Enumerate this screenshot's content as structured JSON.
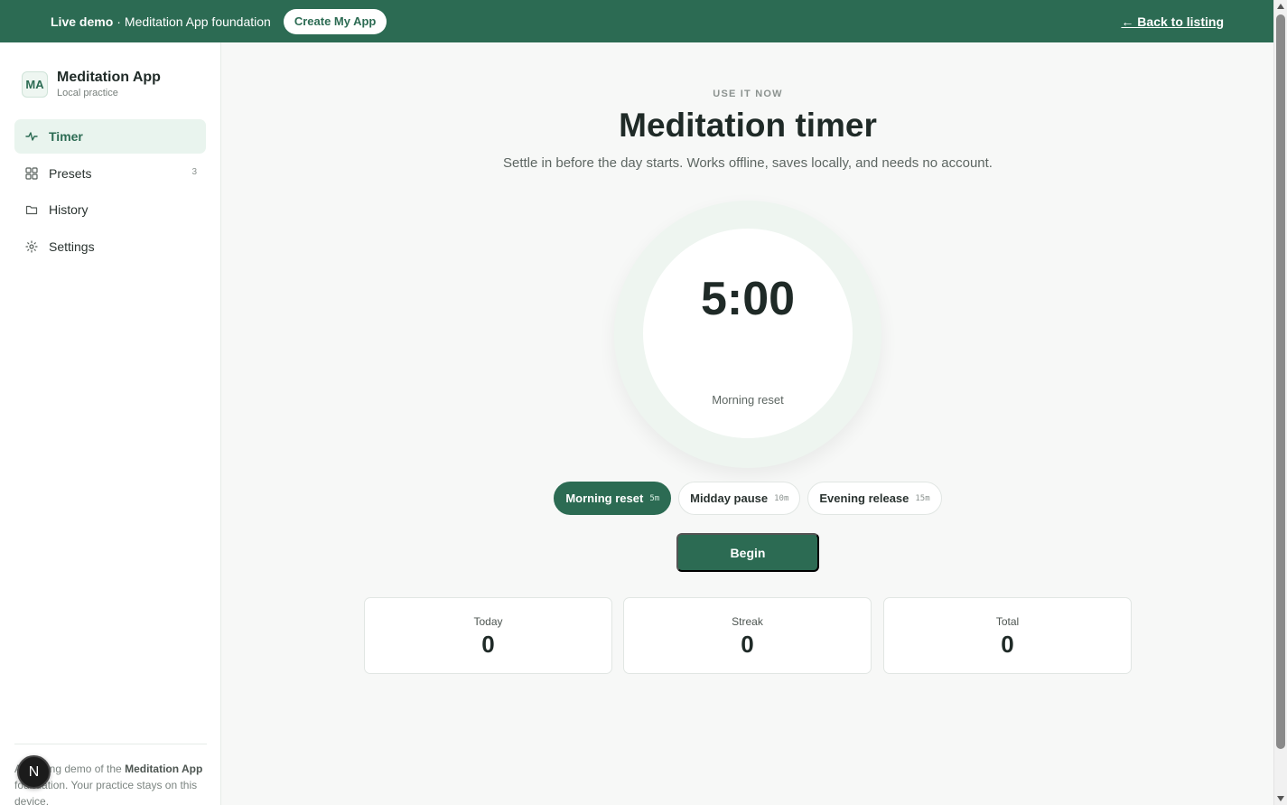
{
  "banner": {
    "live_label": "Live demo",
    "separator": "·",
    "foundation_text": "Meditation App foundation",
    "create_button": "Create My App",
    "back_link": "← Back to listing"
  },
  "sidebar": {
    "logo_initials": "MA",
    "app_name": "Meditation App",
    "app_subtitle": "Local practice",
    "items": [
      {
        "label": "Timer",
        "icon": "activity-icon",
        "active": true
      },
      {
        "label": "Presets",
        "icon": "grid-icon",
        "count": "3"
      },
      {
        "label": "History",
        "icon": "folder-icon"
      },
      {
        "label": "Settings",
        "icon": "gear-icon"
      }
    ],
    "footer": {
      "text_a": "A working demo of the ",
      "app_bold": "Meditation App",
      "text_b": " foundation. Your practice stays on this device."
    },
    "badge_letter": "N"
  },
  "main": {
    "eyebrow": "USE IT NOW",
    "title": "Meditation timer",
    "subtitle": "Settle in before the day starts. Works offline, saves locally, and needs no account.",
    "timer": {
      "time": "5:00",
      "preset": "Morning reset"
    },
    "presets": [
      {
        "label": "Morning reset",
        "duration": "5m",
        "active": true
      },
      {
        "label": "Midday pause",
        "duration": "10m"
      },
      {
        "label": "Evening release",
        "duration": "15m"
      }
    ],
    "begin_button": "Begin",
    "stats": [
      {
        "label": "Today",
        "value": "0"
      },
      {
        "label": "Streak",
        "value": "0"
      },
      {
        "label": "Total",
        "value": "0"
      }
    ]
  },
  "colors": {
    "brand": "#2c6b53",
    "brand_light": "#e9f4ee"
  }
}
